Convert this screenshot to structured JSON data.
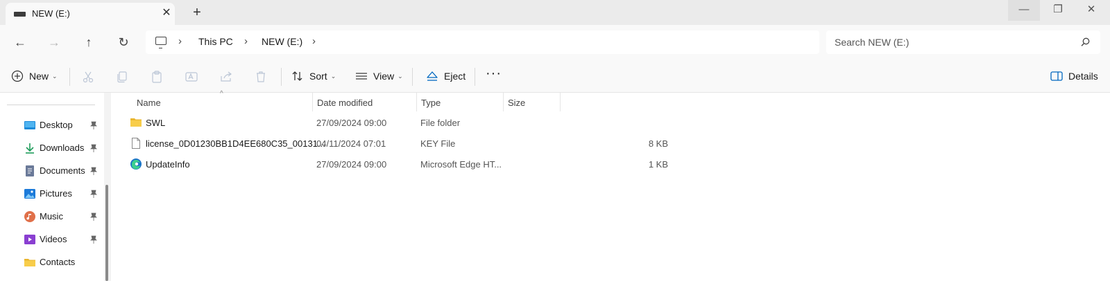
{
  "window": {
    "tab_title": "NEW (E:)",
    "close_glyph": "✕",
    "new_tab_glyph": "+",
    "minimize_glyph": "—",
    "maximize_glyph": "❐",
    "close_window_glyph": "✕"
  },
  "nav": {
    "back_glyph": "←",
    "forward_glyph": "→",
    "up_glyph": "↑",
    "refresh_glyph": "↻"
  },
  "breadcrumb": {
    "items": [
      "This PC",
      "NEW (E:)"
    ],
    "separator": "›"
  },
  "search": {
    "placeholder": "Search NEW (E:)"
  },
  "toolbar": {
    "new_label": "New",
    "sort_label": "Sort",
    "view_label": "View",
    "eject_label": "Eject",
    "more_glyph": "···",
    "details_label": "Details",
    "caret": "⌄"
  },
  "sidebar": {
    "items": [
      {
        "label": "Desktop",
        "icon": "desktop-icon",
        "pinned": true
      },
      {
        "label": "Downloads",
        "icon": "download-icon",
        "pinned": true
      },
      {
        "label": "Documents",
        "icon": "document-icon",
        "pinned": true
      },
      {
        "label": "Pictures",
        "icon": "pictures-icon",
        "pinned": true
      },
      {
        "label": "Music",
        "icon": "music-icon",
        "pinned": true
      },
      {
        "label": "Videos",
        "icon": "videos-icon",
        "pinned": true
      },
      {
        "label": "Contacts",
        "icon": "folder-icon",
        "pinned": false
      }
    ]
  },
  "columns": {
    "name": "Name",
    "date": "Date modified",
    "type": "Type",
    "size": "Size",
    "sort_glyph": "^"
  },
  "files": [
    {
      "name": "SWL",
      "date": "27/09/2024 09:00",
      "type": "File folder",
      "size": "",
      "icon": "folder-icon"
    },
    {
      "name": "license_0D01230BB1D4EE680C35_00131...",
      "date": "04/11/2024 07:01",
      "type": "KEY File",
      "size": "8 KB",
      "icon": "file-icon"
    },
    {
      "name": "UpdateInfo",
      "date": "27/09/2024 09:00",
      "type": "Microsoft Edge HT...",
      "size": "1 KB",
      "icon": "edge-icon"
    }
  ],
  "colors": {
    "accent": "#0067c0",
    "folder": "#f4c542"
  }
}
